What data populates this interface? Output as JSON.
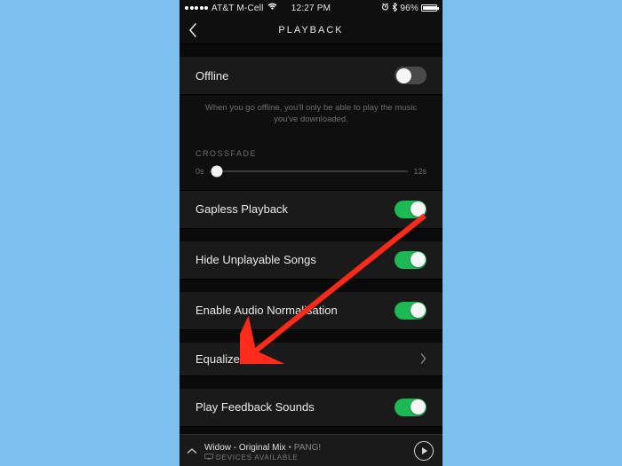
{
  "status": {
    "carrier": "AT&T M-Cell",
    "wifi_icon": "wifi",
    "time": "12:27 PM",
    "alarm_icon": "alarm",
    "bluetooth_icon": "bluetooth",
    "battery_pct": "96%"
  },
  "header": {
    "title": "PLAYBACK"
  },
  "offline": {
    "label": "Offline",
    "helper": "When you go offline, you'll only be able to play the music you've downloaded.",
    "enabled": false
  },
  "crossfade": {
    "section_label": "CROSSFADE",
    "min_label": "0s",
    "max_label": "12s"
  },
  "rows": {
    "gapless": {
      "label": "Gapless Playback",
      "enabled": true
    },
    "hide_unplayable": {
      "label": "Hide Unplayable Songs",
      "enabled": true
    },
    "normalisation": {
      "label": "Enable Audio Normalisation",
      "enabled": true
    },
    "equalizer": {
      "label": "Equalizer"
    },
    "feedback_sounds": {
      "label": "Play Feedback Sounds",
      "enabled": true
    }
  },
  "now_playing": {
    "title": "Widow - Original Mix",
    "separator": " • ",
    "artist": "PANG!",
    "devices_label": "DEVICES AVAILABLE"
  },
  "colors": {
    "accent_green": "#1db954",
    "arrow_red": "#ff2a1a"
  }
}
